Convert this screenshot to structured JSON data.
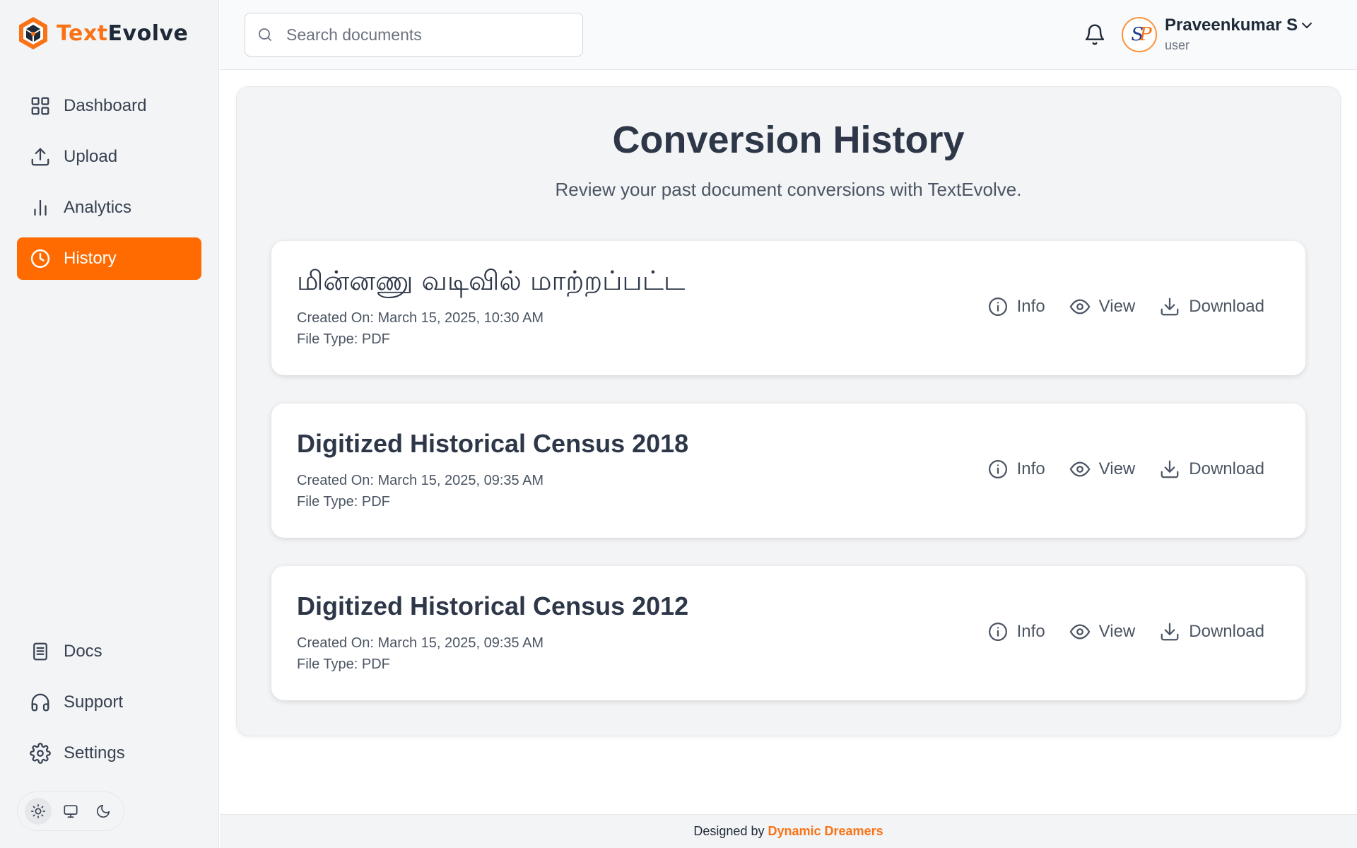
{
  "brand": {
    "name_part1": "Text",
    "name_part2": "Evolve"
  },
  "sidebar": {
    "items": [
      {
        "label": "Dashboard",
        "icon": "grid-icon"
      },
      {
        "label": "Upload",
        "icon": "upload-icon"
      },
      {
        "label": "Analytics",
        "icon": "bar-chart-icon"
      },
      {
        "label": "History",
        "icon": "clock-icon",
        "active": true
      }
    ],
    "bottom_items": [
      {
        "label": "Docs",
        "icon": "document-icon"
      },
      {
        "label": "Support",
        "icon": "headphones-icon"
      },
      {
        "label": "Settings",
        "icon": "gear-icon"
      }
    ],
    "theme_options": [
      "light",
      "system",
      "dark"
    ],
    "theme_selected": "light"
  },
  "header": {
    "search_placeholder": "Search documents",
    "user": {
      "name": "Praveenkumar S",
      "role": "user"
    }
  },
  "main": {
    "title": "Conversion History",
    "subtitle": "Review your past document conversions with TextEvolve.",
    "cards": [
      {
        "title": "மின்னணு வடிவில் மாற்றப்பட்ட",
        "created": "Created On: March 15, 2025, 10:30 AM",
        "file_type": "File Type: PDF"
      },
      {
        "title": "Digitized Historical Census 2018",
        "created": "Created On: March 15, 2025, 09:35 AM",
        "file_type": "File Type: PDF"
      },
      {
        "title": "Digitized Historical Census 2012",
        "created": "Created On: March 15, 2025, 09:35 AM",
        "file_type": "File Type: PDF"
      }
    ],
    "action_labels": {
      "info": "Info",
      "view": "View",
      "download": "Download"
    }
  },
  "footer": {
    "prefix": "Designed by",
    "brand": "Dynamic Dreamers"
  },
  "colors": {
    "accent": "#ff6b00",
    "brand_orange": "#f97316",
    "text_dark": "#2d3748"
  }
}
